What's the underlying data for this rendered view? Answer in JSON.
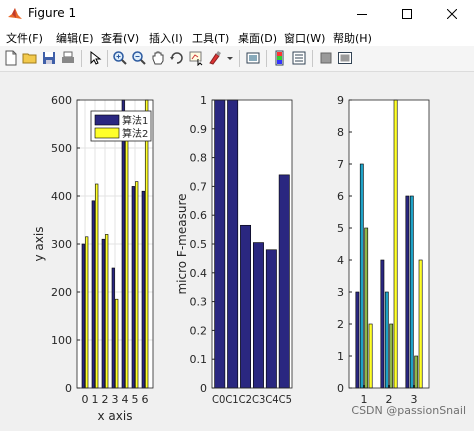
{
  "window": {
    "title": "Figure 1"
  },
  "menu": [
    {
      "label": "文件(F)"
    },
    {
      "label": "编辑(E)"
    },
    {
      "label": "查看(V)"
    },
    {
      "label": "插入(I)"
    },
    {
      "label": "工具(T)"
    },
    {
      "label": "桌面(D)"
    },
    {
      "label": "窗口(W)"
    },
    {
      "label": "帮助(H)"
    }
  ],
  "toolbar": [
    "new-figure",
    "open",
    "save",
    "print",
    "pointer",
    "zoom-in",
    "zoom-out",
    "pan",
    "rotate",
    "data-cursor",
    "brush",
    "link",
    "new-plot",
    "insert-colorbar",
    "insert-legend",
    "hide-plot-tools",
    "show-plot-tools"
  ],
  "colors": {
    "navy": "#2a2780",
    "yellow": "#ffff2a",
    "teal": "#1ea2c7",
    "olive": "#8fb64a"
  },
  "watermark": "CSDN @passionSnail",
  "chart_data": [
    {
      "type": "bar",
      "xlabel": "x axis",
      "ylabel": "y axis",
      "xticks": [
        "0",
        "1",
        "2",
        "3",
        "4",
        "5",
        "6"
      ],
      "yticks": [
        "0",
        "100",
        "200",
        "300",
        "400",
        "500",
        "600"
      ],
      "ylim": [
        0,
        600
      ],
      "grid": true,
      "legend": "top-right",
      "series": [
        {
          "name": "算法1",
          "color": "#2a2780",
          "values": [
            300,
            390,
            310,
            250,
            600,
            420,
            410
          ]
        },
        {
          "name": "算法2",
          "color": "#ffff2a",
          "values": [
            315,
            425,
            320,
            185,
            520,
            430,
            600
          ]
        }
      ]
    },
    {
      "type": "bar",
      "xlabel": "",
      "ylabel": "micro F-measure",
      "categories": [
        "C0",
        "C1",
        "C2",
        "C3",
        "C4",
        "C5"
      ],
      "xticklabels": "C0C1C2C3C4C5",
      "yticks": [
        "0",
        "0.1",
        "0.2",
        "0.3",
        "0.4",
        "0.5",
        "0.6",
        "0.7",
        "0.8",
        "0.9",
        "1"
      ],
      "ylim": [
        0,
        1
      ],
      "values": [
        1.0,
        1.0,
        0.565,
        0.505,
        0.48,
        0.74
      ],
      "color": "#2a2780"
    },
    {
      "type": "bar",
      "categories": [
        "1",
        "2",
        "3"
      ],
      "yticks": [
        "0",
        "1",
        "2",
        "3",
        "4",
        "5",
        "6",
        "7",
        "8",
        "9"
      ],
      "ylim": [
        0,
        9
      ],
      "series": [
        {
          "color": "#2a2780",
          "values": [
            3,
            4,
            6
          ]
        },
        {
          "color": "#1ea2c7",
          "values": [
            7,
            3,
            6
          ]
        },
        {
          "color": "#8fb64a",
          "values": [
            5,
            2,
            1
          ]
        },
        {
          "color": "#ffff2a",
          "values": [
            2,
            9,
            4
          ]
        }
      ]
    }
  ]
}
